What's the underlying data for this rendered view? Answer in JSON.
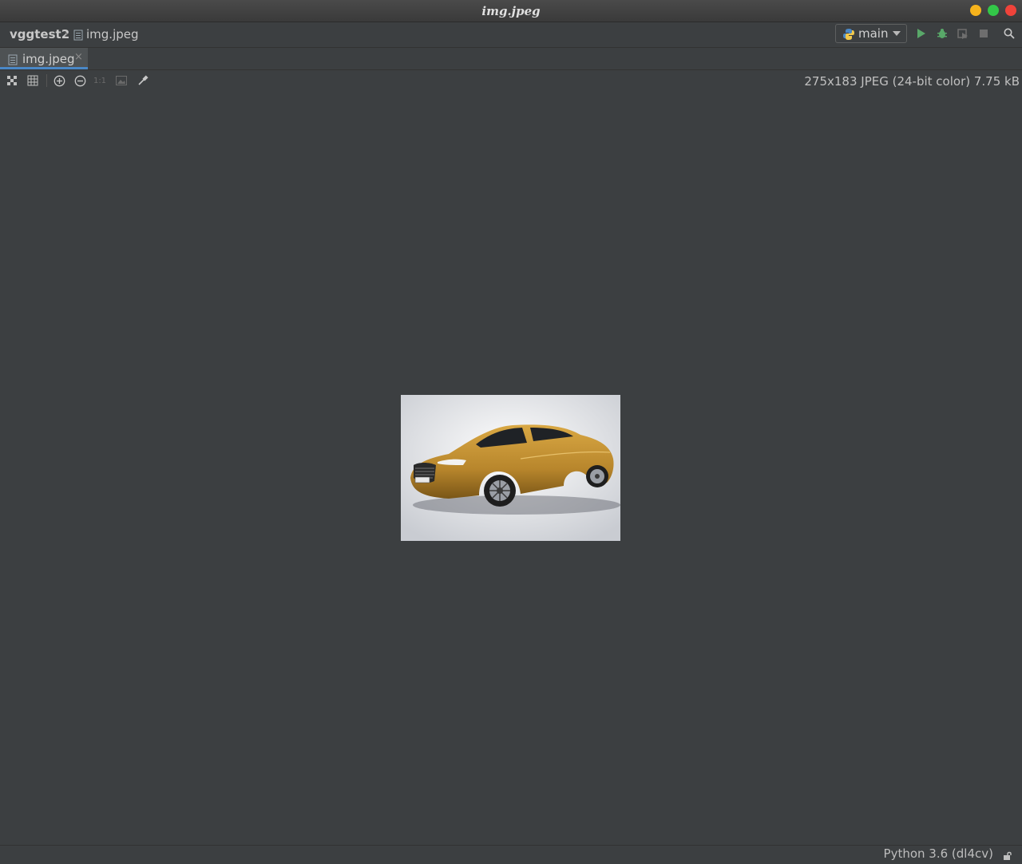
{
  "window": {
    "title": "img.jpeg"
  },
  "breadcrumb": {
    "project": "vggtest2",
    "file": "img.jpeg"
  },
  "run_config": {
    "name": "main"
  },
  "tabs": [
    {
      "label": "img.jpeg",
      "close": "×"
    }
  ],
  "viewer": {
    "actual_size_label": "1:1",
    "image_info": "275x183 JPEG (24-bit color) 7.75 kB"
  },
  "status": {
    "interpreter": "Python 3.6 (dl4cv)"
  },
  "colors": {
    "background": "#3c3f41",
    "accent": "#4a88c7",
    "run": "#59a869",
    "car_body": "#b8862c"
  }
}
